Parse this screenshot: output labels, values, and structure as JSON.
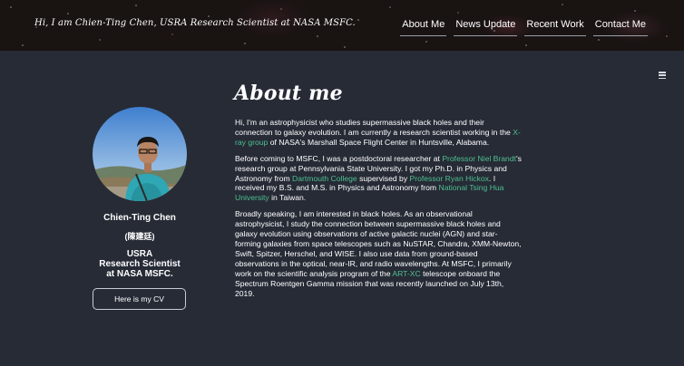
{
  "header": {
    "tagline": "Hi, I am Chien-Ting Chen, USRA Research Scientist at NASA MSFC.",
    "nav": [
      {
        "label": "About Me"
      },
      {
        "label": "News Update"
      },
      {
        "label": "Recent Work"
      },
      {
        "label": "Contact Me"
      }
    ],
    "menu_icon": "hamburger-menu-icon"
  },
  "profile": {
    "name": "Chien-Ting Chen",
    "name_cn": "(陳建廷)",
    "role_line1": "USRA",
    "role_line2": "Research Scientist",
    "role_line3": "at NASA MSFC.",
    "cv_button": "Here is my CV"
  },
  "about": {
    "title": "About me",
    "p1": {
      "t1": "Hi, I'm an astrophysicist who studies supermassive black holes and their connection to galaxy evolution. I am currently a research scientist working in the ",
      "link1": "X-ray group",
      "t2": " of NASA's Marshall Space Flight Center in Huntsville, Alabama."
    },
    "p2": {
      "t1": "Before coming to MSFC, I was a postdoctoral researcher at ",
      "link1": "Professor Niel Brandt",
      "t2": "'s research group at Pennsylvania State University. I got my Ph.D. in Physics and Astronomy from ",
      "link2": "Dartmouth College",
      "t3": " supervised by ",
      "link3": "Professor Ryan Hickox",
      "t4": ". I received my B.S. and M.S. in Physics and Astronomy from ",
      "link4": "National Tsing Hua University",
      "t5": " in Taiwan."
    },
    "p3": {
      "t1": "Broadly speaking, I am interested in black holes. As an observational astrophysicist, I study the connection between supermassive black holes and galaxy evolution using observations of active galactic nuclei (AGN) and star-forming galaxies from space telescopes such as NuSTAR, Chandra, XMM-Newton, Swift, Spitzer, Herschel, and WISE. I also use data from ground-based observations in the optical, near-IR, and radio wavelengths. At MSFC, I primarily work on the scientific analysis program of the ",
      "link1": "ART-XC",
      "t2": " telescope onboard the Spectrum Roentgen Gamma mission that was recently launched on July 13th, 2019."
    }
  },
  "colors": {
    "background": "#262b36",
    "link": "#4fbf8f",
    "text": "#ffffff"
  }
}
